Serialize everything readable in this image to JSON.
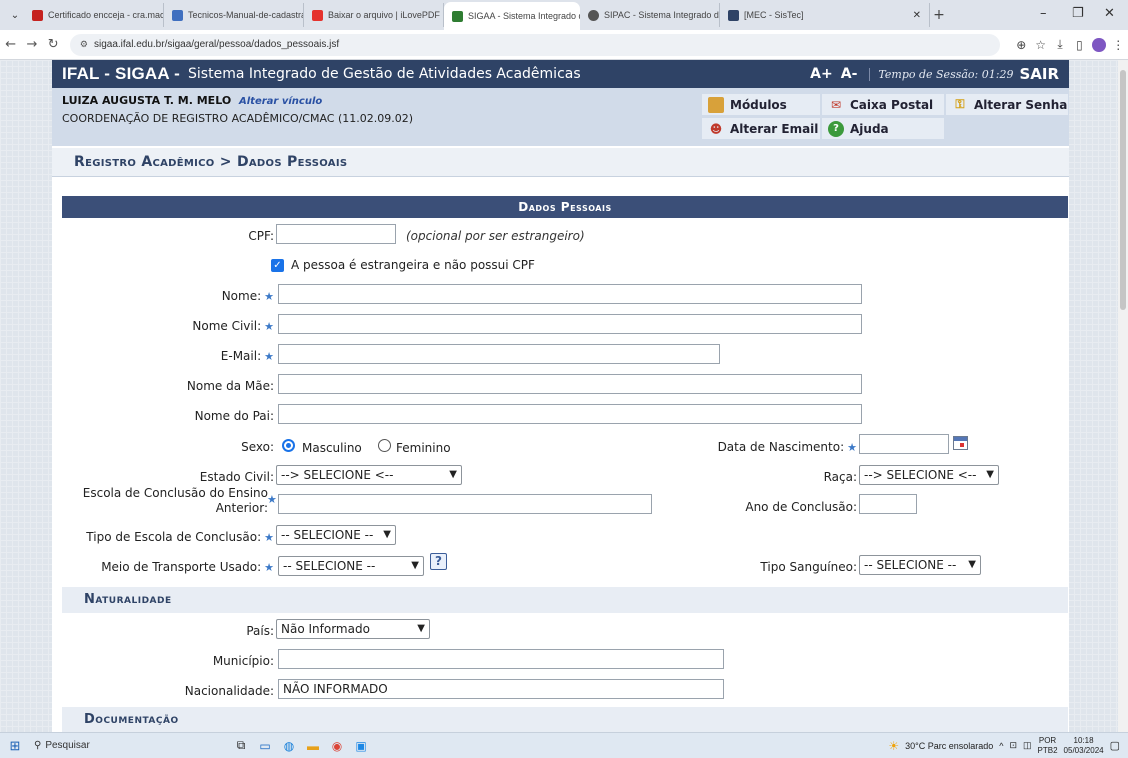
{
  "browser": {
    "tabs": [
      {
        "title": "Certificado encceja - cra.macei",
        "fav": "#c5221f"
      },
      {
        "title": "Tecnicos-Manual-de-cadastram",
        "fav": "#3f6fbf"
      },
      {
        "title": "Baixar o arquivo | iLovePDF",
        "fav": "#e5322d"
      },
      {
        "title": "SIGAA - Sistema Integrado de G",
        "fav": "#2f7d32"
      },
      {
        "title": "SIPAC - Sistema Integrado de P",
        "fav": "#555555"
      },
      {
        "title": "[MEC - SisTec]",
        "fav": "#2f4366"
      }
    ],
    "url": "sigaa.ifal.edu.br/sigaa/geral/pessoa/dados_pessoais.jsf"
  },
  "header": {
    "brand": "IFAL - SIGAA -",
    "fullname": "Sistema Integrado de Gestão de Atividades Acadêmicas",
    "font_up": "A+",
    "font_down": "A-",
    "session": "Tempo de Sessão: 01:29",
    "logout": "SAIR"
  },
  "user": {
    "name": "LUIZA AUGUSTA T. M. MELO",
    "alter_vinculo": "Alterar vínculo",
    "unit": "COORDENAÇÃO DE REGISTRO ACADÊMICO/CMAC (11.02.09.02)"
  },
  "menu": {
    "modulos": "Módulos",
    "caixa_postal": "Caixa Postal",
    "alterar_senha": "Alterar Senha",
    "alterar_email": "Alterar Email",
    "ajuda": "Ajuda"
  },
  "breadcrumb": "Registro Acadêmico > Dados Pessoais",
  "form": {
    "caption": "Dados Pessoais",
    "cpf_label": "CPF:",
    "cpf_note": "(opcional por ser estrangeiro)",
    "foreign_label": "A pessoa é estrangeira e não possui CPF",
    "nome_label": "Nome:",
    "nome_civil_label": "Nome Civil:",
    "email_label": "E-Mail:",
    "mae_label": "Nome da Mãe:",
    "pai_label": "Nome do Pai:",
    "sexo_label": "Sexo:",
    "masculino": "Masculino",
    "feminino": "Feminino",
    "nascimento_label": "Data de Nascimento:",
    "estado_civil_label": "Estado Civil:",
    "estado_civil_value": "--> SELECIONE <--",
    "raca_label": "Raça:",
    "raca_value": "--> SELECIONE <--",
    "escola_label_1": "Escola de Conclusão do Ensino",
    "escola_label_2": "Anterior:",
    "ano_label": "Ano de Conclusão:",
    "tipo_escola_label": "Tipo de Escola de Conclusão:",
    "tipo_escola_value": "-- SELECIONE --",
    "transporte_label": "Meio de Transporte Usado:",
    "transporte_value": "-- SELECIONE --",
    "sangue_label": "Tipo Sanguíneo:",
    "sangue_value": "-- SELECIONE --"
  },
  "naturalidade": {
    "title": "Naturalidade",
    "pais_label": "País:",
    "pais_value": "Não Informado",
    "municipio_label": "Município:",
    "nacionalidade_label": "Nacionalidade:",
    "nacionalidade_value": "NÃO INFORMADO"
  },
  "documentacao": {
    "title": "Documentação"
  },
  "taskbar": {
    "search": "Pesquisar",
    "weather": "30°C  Parc ensolarado",
    "lang_1": "POR",
    "lang_2": "PTB2",
    "time": "10:18",
    "date": "05/03/2024"
  }
}
